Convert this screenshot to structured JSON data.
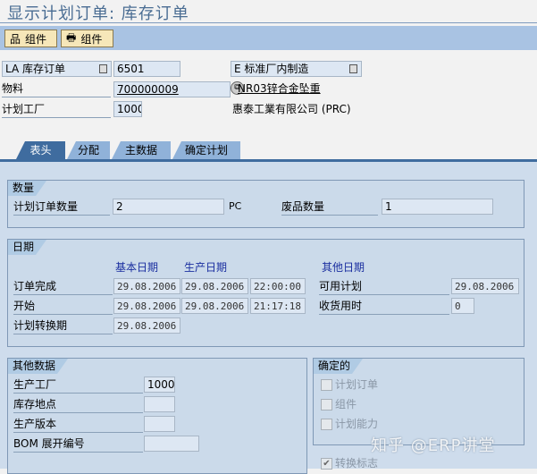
{
  "title": "显示计划订单: 库存订单",
  "toolbar": {
    "buttons": [
      {
        "label": "组件",
        "icon": "hierarchy-icon"
      },
      {
        "label": "组件",
        "icon": "printer-icon"
      }
    ]
  },
  "header": {
    "order_type": "LA 库存订单",
    "order_number": "6501",
    "procurement": "E 标准厂内制造",
    "material_label": "物料",
    "material": "700000009",
    "material_desc": "NR03锌合金坠重",
    "plant_label": "计划工厂",
    "plant": "1000",
    "plant_name": "惠泰工業有限公司 (PRC)"
  },
  "tabs": [
    {
      "label": "表头",
      "active": true
    },
    {
      "label": "分配"
    },
    {
      "label": "主数据"
    },
    {
      "label": "确定计划"
    }
  ],
  "quantity": {
    "title": "数量",
    "order_qty_label": "计划订单数量",
    "order_qty": "2",
    "unit": "PC",
    "scrap_label": "废品数量",
    "scrap": "1"
  },
  "dates": {
    "title": "日期",
    "col_basic": "基本日期",
    "col_prod": "生产日期",
    "col_other": "其他日期",
    "rows": [
      {
        "label": "订单完成",
        "basic": "29.08.2006",
        "prod": "29.08.2006",
        "time": "22:00:00"
      },
      {
        "label": "开始",
        "basic": "29.08.2006",
        "prod": "29.08.2006",
        "time": "21:17:18"
      },
      {
        "label": "计划转换期",
        "basic": "29.08.2006"
      }
    ],
    "avail_label": "可用计划",
    "avail": "29.08.2006",
    "gr_label": "收货用时",
    "gr": "0"
  },
  "other": {
    "title": "其他数据",
    "prod_plant_label": "生产工厂",
    "prod_plant": "1000",
    "sloc_label": "库存地点",
    "sloc": "",
    "version_label": "生产版本",
    "version": "",
    "bom_label": "BOM 展开编号",
    "bom": ""
  },
  "firm": {
    "title": "确定的",
    "items": [
      {
        "label": "计划订单",
        "checked": false
      },
      {
        "label": "组件",
        "checked": false
      },
      {
        "label": "计划能力",
        "checked": false
      }
    ],
    "convert_label": "转换标志",
    "convert_checked": true
  },
  "watermark": "知乎 @ERP讲堂"
}
